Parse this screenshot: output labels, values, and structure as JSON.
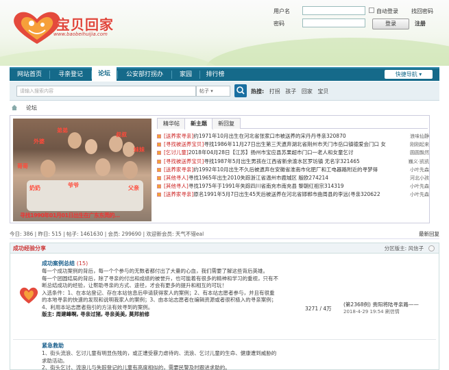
{
  "site": {
    "logo_text": "宝贝回家",
    "logo_url": "www.baobeihuijia.com"
  },
  "login": {
    "username_label": "用户名",
    "password_label": "密码",
    "auto_login_label": "自动登录",
    "forgot_password": "找回密码",
    "login_button": "登录",
    "register_link": "注册"
  },
  "nav": {
    "items": [
      "网站首页",
      "寻亲登记",
      "论坛",
      "公安部打拐办",
      "家园",
      "排行榜"
    ],
    "active_index": 2,
    "quick_nav": "快捷导航 ▾"
  },
  "search": {
    "placeholder": "请输入搜索内容",
    "type": "帖子 ▾",
    "hot_label": "热搜:",
    "hot_terms": [
      "打拐",
      "孩子",
      "回家",
      "宝贝"
    ]
  },
  "breadcrumb": "论坛",
  "photo": {
    "tags": [
      "外婆",
      "弟弟",
      "叔叔",
      "妹妹",
      "哥哥",
      "奶奶",
      "爷爷",
      "父亲"
    ],
    "caption": "寻找1990年01月01日出生在广东东莞的..."
  },
  "tabs": [
    "精华帖",
    "新主题",
    "新回复"
  ],
  "active_tab": 1,
  "threads": [
    {
      "cat": "[送养家寻亲]",
      "title": "约1971年10月出生在河北省张家口市被送养的宋丹丹寻亲320870",
      "author": "浪味仙静"
    },
    {
      "cat": "[寻找被送养宝贝]",
      "title": "寻找1986年11月27日出生第三天遗弃湖北省荆州市天门市岳口镇德爱会门口 女",
      "author": "刚刚起来"
    },
    {
      "cat": "[乞讨儿童]",
      "title": "2018年04月28日【江苏】扬州市宝应县苏果超市门口一老人和女童乞讨",
      "author": "圆圆飘然"
    },
    {
      "cat": "[寻找被送养宝贝]",
      "title": "寻找1987年5月出生男孩在江西省新余渝水区罗坊镇 无名字321465",
      "author": "巍义·凯凯"
    },
    {
      "cat": "[送养家寻亲]",
      "title": "约1992年10月出生不久后被遗弃在安徽省淮南市化肥厂和工电器路附近的寻梦得",
      "author": "小叶先森"
    },
    {
      "cat": "[其他寻人]",
      "title": "寻找1965年出生2010失踪浙江省温州市鹿城区 殷欧274214",
      "author": "河北小孩"
    },
    {
      "cat": "[其他寻人]",
      "title": "寻找1975年于1991年失踪四川省南充市南充县 黎朝红祖宗314319",
      "author": "小叶先森"
    },
    {
      "cat": "[送养家寻亲]",
      "title": "原名1991年5月7日出生45天后被送养在河北省邯郸市曲周县的李远(寻亲320622",
      "author": "小叶先森"
    }
  ],
  "stats": {
    "text": "今日: 386 | 昨日: 515 | 帖子: 1461630 | 会员: 299690 | 欢迎新会员: 天气不错eal",
    "latest": "最新回复"
  },
  "section": {
    "title": "成功经验分享",
    "moderator": "分区版主: 风信子"
  },
  "forums": [
    {
      "name": "成功案例总结",
      "count": "(15)",
      "desc1": "每一个成功案例的背后，每一个个参与的无数者都付出了大量的心血，我们需要了解这些背后英雄。",
      "desc2": "每一个团圆结局的背后，除了寻亲的付出和成绩的被誉升，也可能着有很多的精神和学习的重视，只有不断总结成功的经验，让帮助寻亲的方式、途径，才会有更多的提升和相互的可玩！",
      "desc3": "入选条件：1、在本站登记、存在本站信息后申请获得家人的案例；2、有本站志愿者参与，并且有很重的本地寻亲的快速的发现和说明我家人的案例；3、由本站志愿者在编辑资源或者很积极入的寻亲案例；4、利用本站志愿者指引的方法有效寻到的案例。",
      "desc4": "版主: 周建峰啊, 寻亲过猪, 寻亲美美, 莫邦前修",
      "num": "3271 / 4万",
      "last_title": "(第2368例) 贵阳将陆寻亲路——",
      "last_date": "2018-4-29 19:54 刷信情"
    },
    {
      "name": "紧急救助",
      "count": "",
      "desc1": "1、街头流浪、乞讨儿童有明显伤残的，或正遭受暴力虐待的、流浪、乞讨儿童的生命、健康遭到威胁的求助活动。",
      "desc2": "2、街头乞讨、流浪儿与失踪登记的儿童有高度相似的，需要民警及时跟进求助的。"
    }
  ]
}
